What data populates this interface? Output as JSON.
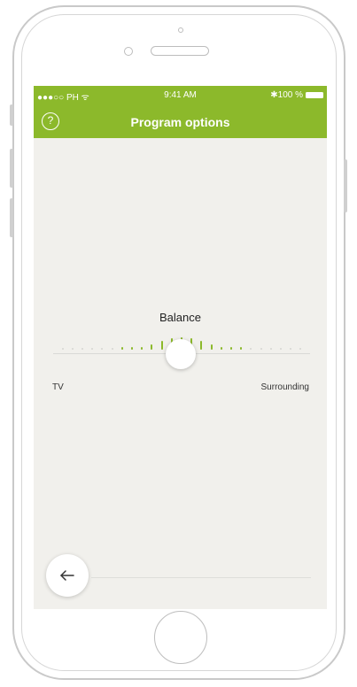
{
  "status_bar": {
    "carrier": "●●●○○ PH ᯤ",
    "time": "9:41 AM",
    "battery_text": "✱100 %"
  },
  "header": {
    "title": "Program options",
    "help_icon": "?"
  },
  "balance": {
    "label": "Balance",
    "left_label": "TV",
    "right_label": "Surrounding",
    "value": 0.5
  },
  "colors": {
    "accent": "#8cb92b",
    "background": "#f1f0ec"
  },
  "icons": {
    "help": "help-icon",
    "back": "back-arrow-icon"
  }
}
